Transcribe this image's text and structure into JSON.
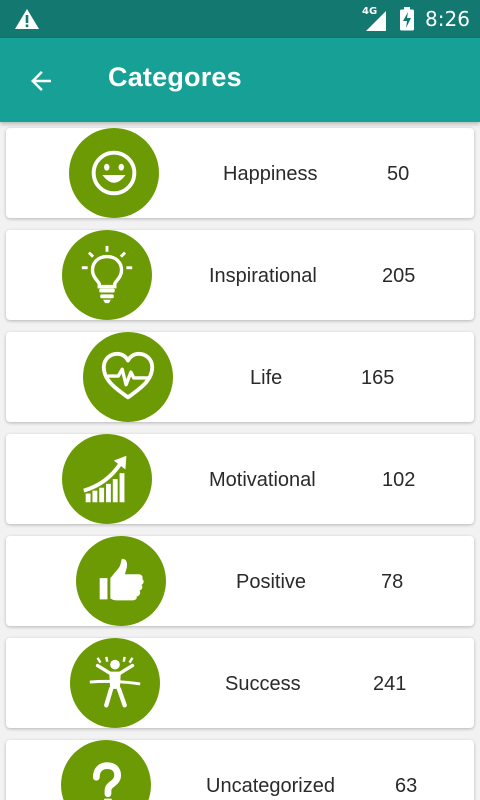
{
  "status_bar": {
    "network": "4G",
    "time": "8:26"
  },
  "app_bar": {
    "title": "Categores"
  },
  "theme": {
    "app_bar_color": "#16a096",
    "status_bar_color": "#127870",
    "icon_circle_color": "#6b9a05"
  },
  "categories": [
    {
      "label": "Happiness",
      "count": "50",
      "icon": "smiley-icon"
    },
    {
      "label": "Inspirational",
      "count": "205",
      "icon": "lightbulb-icon"
    },
    {
      "label": "Life",
      "count": "165",
      "icon": "heart-pulse-icon"
    },
    {
      "label": "Motivational",
      "count": "102",
      "icon": "growth-chart-icon"
    },
    {
      "label": "Positive",
      "count": "78",
      "icon": "thumbs-up-icon"
    },
    {
      "label": "Success",
      "count": "241",
      "icon": "winner-icon"
    },
    {
      "label": "Uncategorized",
      "count": "63",
      "icon": "question-mark-icon"
    }
  ]
}
